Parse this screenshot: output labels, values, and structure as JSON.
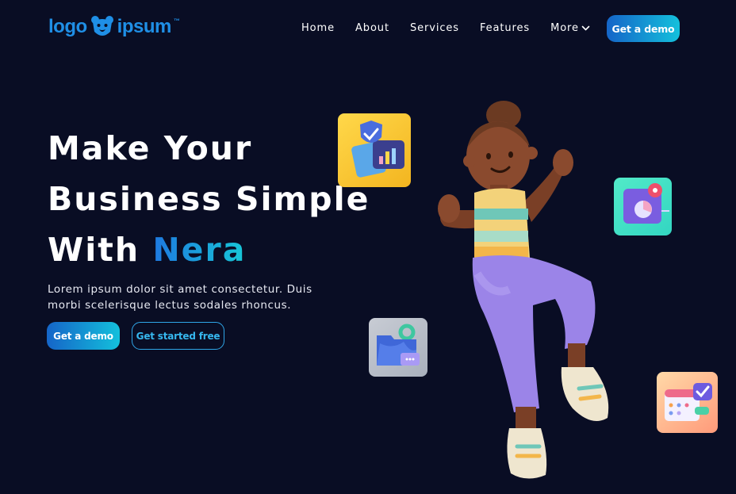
{
  "brand": {
    "logo_left": "logo",
    "logo_right": "ipsum",
    "trademark": "™",
    "logo_icon": "bear-head-icon"
  },
  "nav": {
    "items": [
      "Home",
      "About",
      "Services",
      "Features"
    ],
    "more_label": "More",
    "cta_label": "Get a demo"
  },
  "hero": {
    "headline_line1": "Make Your",
    "headline_line2": "Business Simple",
    "headline_line3_prefix": "With",
    "headline_accent": "Nera",
    "description": "Lorem ipsum dolor sit amet consectetur. Duis morbi scelerisque lectus sodales rhoncus.",
    "primary_button": "Get a demo",
    "secondary_button": "Get started free"
  },
  "colors": {
    "background": "#090d24",
    "accent_start": "#1565c8",
    "accent_end": "#14c0dc",
    "logo": "#1f8fe6"
  },
  "illustrations": {
    "character": "3d-character-jumping",
    "tiles": [
      "shield-chart-icon",
      "chat-analytics-icon",
      "folder-icon",
      "calendar-check-icon"
    ]
  }
}
